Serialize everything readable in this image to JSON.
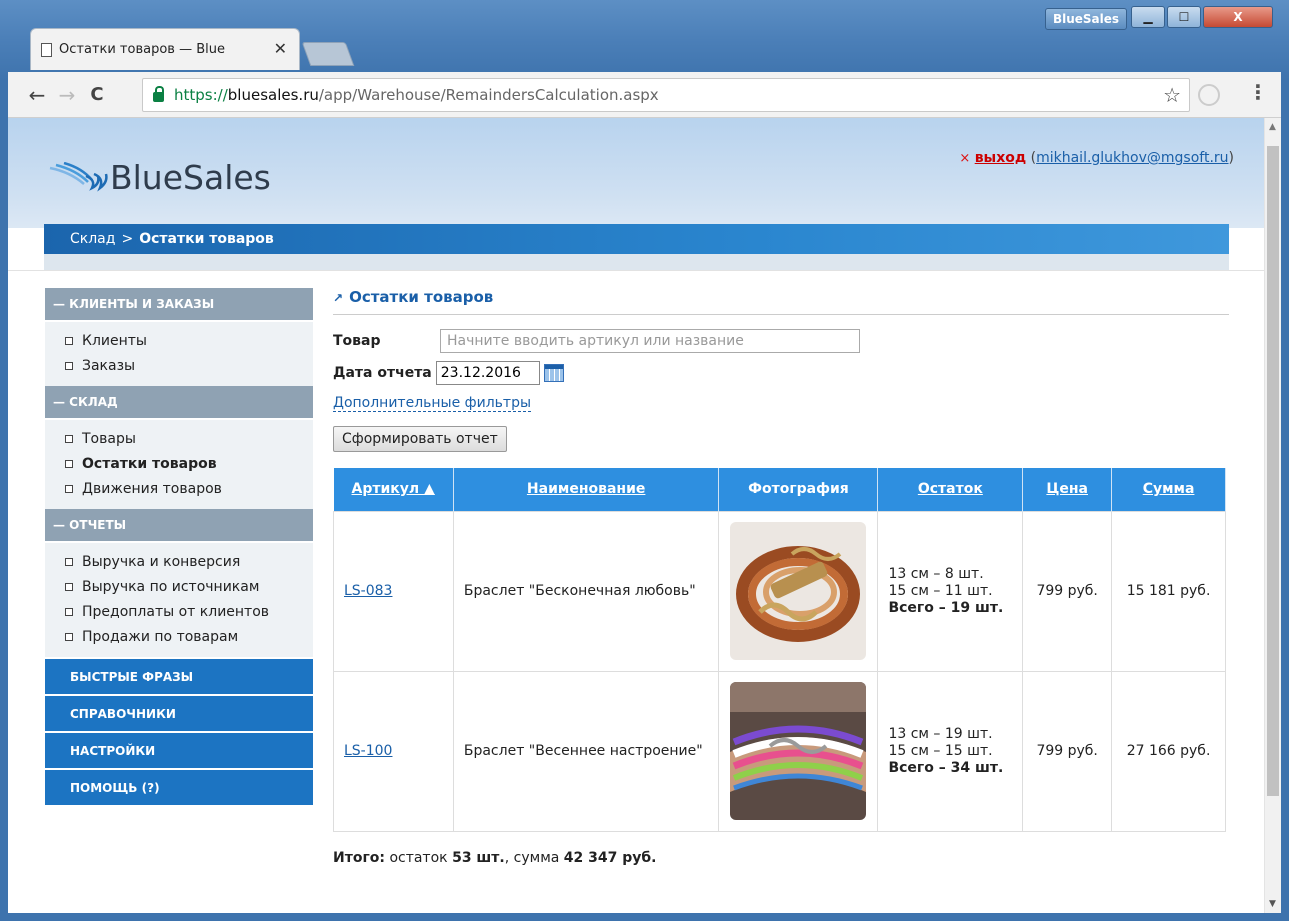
{
  "browser": {
    "tab_title": "Остатки товаров — Blue",
    "tab_close": "✕",
    "profile_badge": "BlueSales",
    "win_min": "▁",
    "win_max": "☐",
    "win_close": "X",
    "nav_back": "←",
    "nav_forward": "→",
    "nav_reload": "C",
    "url_proto": "https://",
    "url_host": "bluesales.ru",
    "url_path": "/app/Warehouse/RemaindersCalculation.aspx",
    "star": "☆",
    "menu": "⋮"
  },
  "header": {
    "logo_text": "BlueSales",
    "logout_x": "×",
    "logout_label": "выход",
    "email": "mikhail.glukhov@mgsoft.ru",
    "paren_open": "(",
    "paren_close": ")"
  },
  "breadcrumb": {
    "parent": "Склад",
    "separator": ">",
    "current": "Остатки товаров"
  },
  "sidebar": {
    "sections": [
      {
        "title": "— КЛИЕНТЫ И ЗАКАЗЫ",
        "items": [
          "Клиенты",
          "Заказы"
        ]
      },
      {
        "title": "— СКЛАД",
        "items": [
          "Товары",
          "Остатки товаров",
          "Движения товаров"
        ]
      },
      {
        "title": "— ОТЧЕТЫ",
        "items": [
          "Выручка и конверсия",
          "Выручка по источникам",
          "Предоплаты от клиентов",
          "Продажи по товарам"
        ]
      }
    ],
    "links": [
      "БЫСТРЫЕ ФРАЗЫ",
      "СПРАВОЧНИКИ",
      "НАСТРОЙКИ",
      "ПОМОЩЬ (?)"
    ]
  },
  "main": {
    "title_arrow": "↗",
    "title": "Остатки товаров",
    "product_label": "Товар",
    "product_placeholder": "Начните вводить артикул или название",
    "date_label": "Дата отчета",
    "date_value": "23.12.2016",
    "filters_link": "Дополнительные фильтры",
    "generate_button": "Сформировать отчет"
  },
  "table": {
    "headers": [
      "Артикул ▲",
      "Наименование",
      "Фотография",
      "Остаток",
      "Цена",
      "Сумма"
    ],
    "rows": [
      {
        "sku": "LS-083",
        "name": "Браслет \"Бесконечная любовь\"",
        "photo": "bracelet-brown-photo",
        "stock": [
          "13 см – 8 шт.",
          "15 см – 11 шт."
        ],
        "stock_total": "Всего – 19 шт.",
        "price": "799 руб.",
        "sum": "15 181 руб."
      },
      {
        "sku": "LS-100",
        "name": "Браслет \"Весеннее настроение\"",
        "photo": "bracelet-colorful-photo",
        "stock": [
          "13 см – 19 шт.",
          "15 см – 15 шт."
        ],
        "stock_total": "Всего – 34 шт.",
        "price": "799 руб.",
        "sum": "27 166 руб."
      }
    ]
  },
  "totals": {
    "label": "Итого:",
    "stock_text": "остаток",
    "stock_value": "53 шт.",
    "sum_text": ", сумма",
    "sum_value": "42 347 руб."
  },
  "colors": {
    "accent": "#2e8fe0",
    "sidebar_head": "#8fa2b3",
    "sidebar_blue": "#1c74c2",
    "link": "#1a5fa8",
    "logout": "#cc0000"
  }
}
